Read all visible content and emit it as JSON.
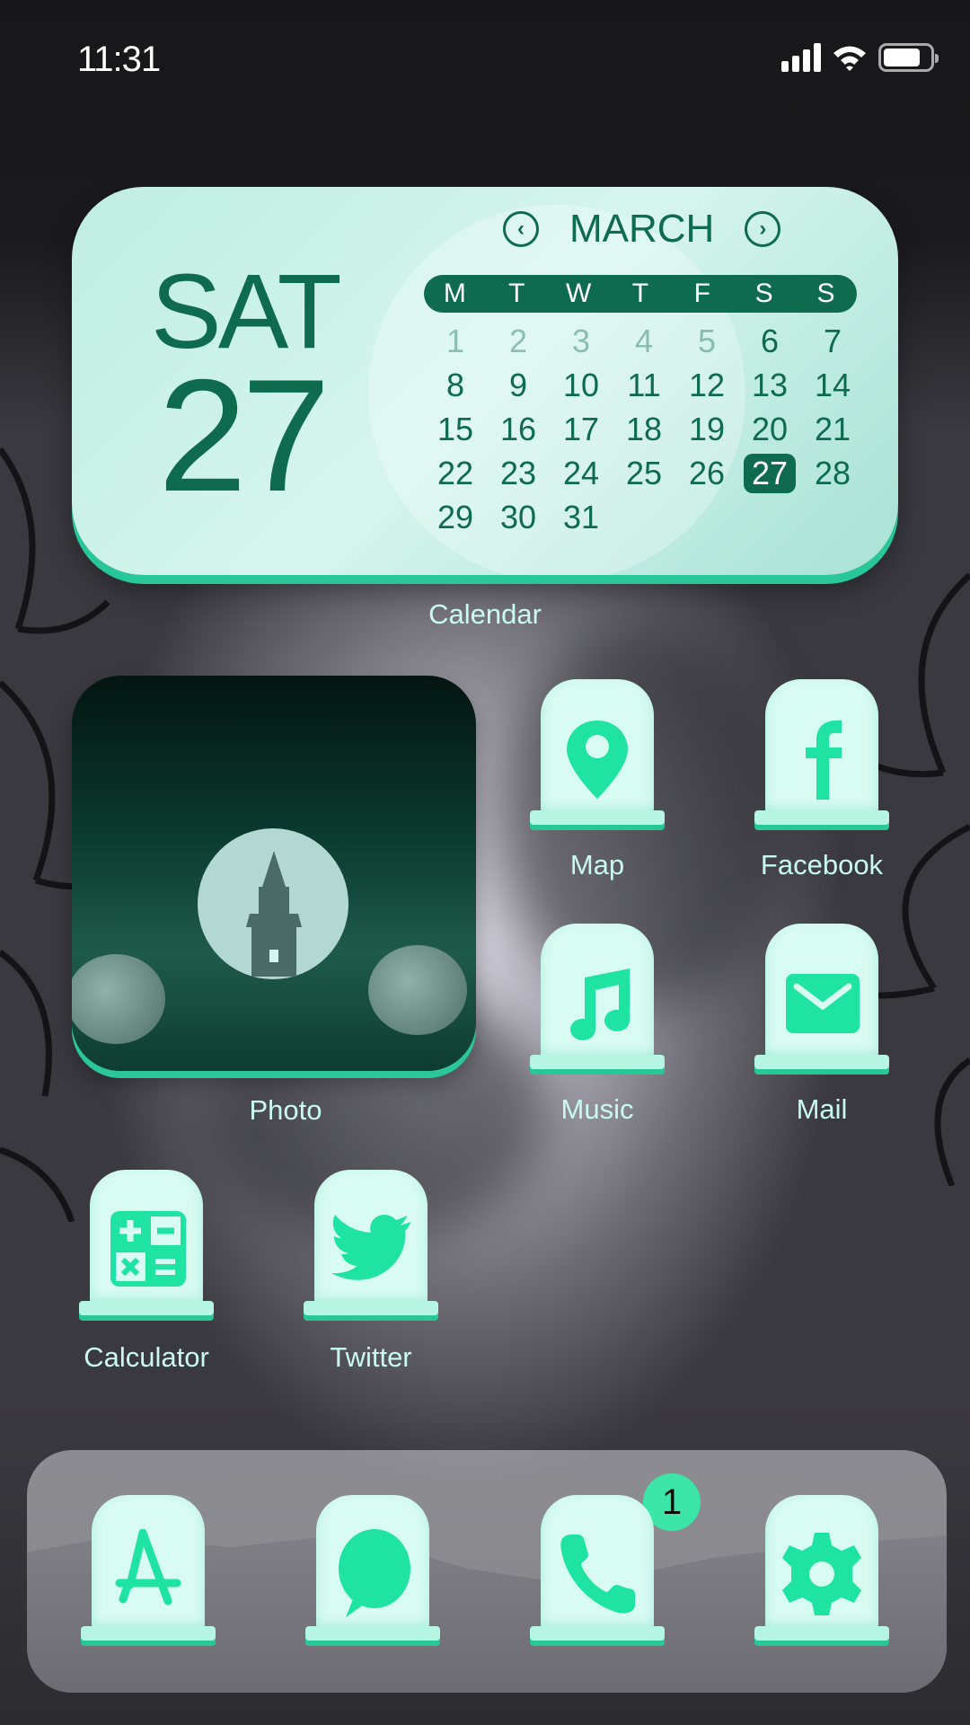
{
  "status_bar": {
    "time": "11:31",
    "signal_icon": "cellular-signal-icon",
    "wifi_icon": "wifi-icon",
    "battery_icon": "battery-icon"
  },
  "calendar_widget": {
    "weekday": "SAT",
    "date": "27",
    "month": "MARCH",
    "prev_icon": "chevron-left-icon",
    "next_icon": "chevron-right-icon",
    "weekdays": [
      "M",
      "T",
      "W",
      "T",
      "F",
      "S",
      "S"
    ],
    "days": [
      {
        "d": "1",
        "dim": true
      },
      {
        "d": "2",
        "dim": true
      },
      {
        "d": "3",
        "dim": true
      },
      {
        "d": "4",
        "dim": true
      },
      {
        "d": "5",
        "dim": true
      },
      {
        "d": "6"
      },
      {
        "d": "7"
      },
      {
        "d": "8"
      },
      {
        "d": "9"
      },
      {
        "d": "10"
      },
      {
        "d": "11"
      },
      {
        "d": "12"
      },
      {
        "d": "13"
      },
      {
        "d": "14"
      },
      {
        "d": "15"
      },
      {
        "d": "16"
      },
      {
        "d": "17"
      },
      {
        "d": "18"
      },
      {
        "d": "19"
      },
      {
        "d": "20"
      },
      {
        "d": "21"
      },
      {
        "d": "22"
      },
      {
        "d": "23"
      },
      {
        "d": "24"
      },
      {
        "d": "25"
      },
      {
        "d": "26"
      },
      {
        "d": "27",
        "today": true
      },
      {
        "d": "28"
      },
      {
        "d": "29"
      },
      {
        "d": "30"
      },
      {
        "d": "31"
      }
    ],
    "label": "Calendar"
  },
  "photo_widget": {
    "label": "Photo"
  },
  "apps": [
    {
      "name": "Map",
      "icon": "map-pin-icon"
    },
    {
      "name": "Facebook",
      "icon": "facebook-icon"
    },
    {
      "name": "Music",
      "icon": "music-note-icon"
    },
    {
      "name": "Mail",
      "icon": "mail-envelope-icon"
    },
    {
      "name": "Calculator",
      "icon": "calculator-icon"
    },
    {
      "name": "Twitter",
      "icon": "twitter-bird-icon"
    }
  ],
  "dock": {
    "apps": [
      {
        "name": "App Store",
        "icon": "app-store-icon"
      },
      {
        "name": "Messages",
        "icon": "message-bubble-icon"
      },
      {
        "name": "Phone",
        "icon": "phone-icon",
        "badge": "1"
      },
      {
        "name": "Settings",
        "icon": "gear-icon"
      }
    ]
  },
  "colors": {
    "accent": "#1fe3a0",
    "dark_green": "#0e6b4e",
    "label": "#c8fbee",
    "tomb": "#d8fbf2"
  }
}
